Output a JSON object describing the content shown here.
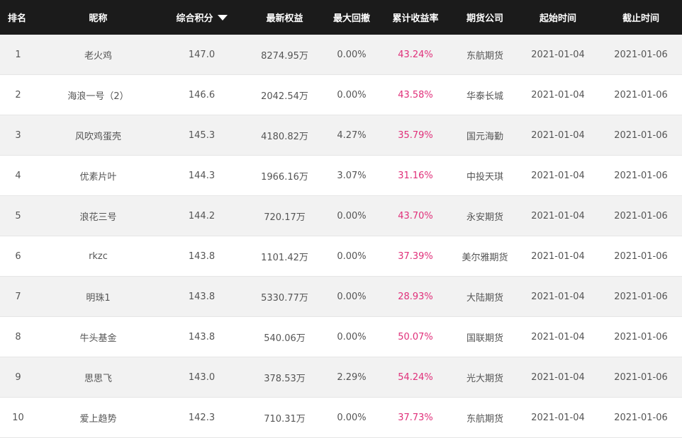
{
  "header": {
    "rank": "排名",
    "nickname": "昵称",
    "score": "综合积分",
    "equity": "最新权益",
    "drawdown": "最大回撤",
    "return": "累计收益率",
    "company": "期货公司",
    "start": "起始时间",
    "end": "截止时间"
  },
  "colors": {
    "header_bg": "#1b1b1b",
    "positive": "#e0307a",
    "stripe": "#f2f2f2"
  },
  "rows": [
    {
      "rank": "1",
      "nickname": "老火鸡",
      "score": "147.0",
      "equity": "8274.95万",
      "drawdown": "0.00%",
      "return": "43.24%",
      "company": "东航期货",
      "start": "2021-01-04",
      "end": "2021-01-06"
    },
    {
      "rank": "2",
      "nickname": "海浪一号（2）",
      "score": "146.6",
      "equity": "2042.54万",
      "drawdown": "0.00%",
      "return": "43.58%",
      "company": "华泰长城",
      "start": "2021-01-04",
      "end": "2021-01-06"
    },
    {
      "rank": "3",
      "nickname": "风吹鸡蛋壳",
      "score": "145.3",
      "equity": "4180.82万",
      "drawdown": "4.27%",
      "return": "35.79%",
      "company": "国元海勤",
      "start": "2021-01-04",
      "end": "2021-01-06"
    },
    {
      "rank": "4",
      "nickname": "优素片叶",
      "score": "144.3",
      "equity": "1966.16万",
      "drawdown": "3.07%",
      "return": "31.16%",
      "company": "中投天琪",
      "start": "2021-01-04",
      "end": "2021-01-06"
    },
    {
      "rank": "5",
      "nickname": "浪花三号",
      "score": "144.2",
      "equity": "720.17万",
      "drawdown": "0.00%",
      "return": "43.70%",
      "company": "永安期货",
      "start": "2021-01-04",
      "end": "2021-01-06"
    },
    {
      "rank": "6",
      "nickname": "rkzc",
      "score": "143.8",
      "equity": "1101.42万",
      "drawdown": "0.00%",
      "return": "37.39%",
      "company": "美尔雅期货",
      "start": "2021-01-04",
      "end": "2021-01-06"
    },
    {
      "rank": "7",
      "nickname": "明珠1",
      "score": "143.8",
      "equity": "5330.77万",
      "drawdown": "0.00%",
      "return": "28.93%",
      "company": "大陆期货",
      "start": "2021-01-04",
      "end": "2021-01-06"
    },
    {
      "rank": "8",
      "nickname": "牛头基金",
      "score": "143.8",
      "equity": "540.06万",
      "drawdown": "0.00%",
      "return": "50.07%",
      "company": "国联期货",
      "start": "2021-01-04",
      "end": "2021-01-06"
    },
    {
      "rank": "9",
      "nickname": "思思飞",
      "score": "143.0",
      "equity": "378.53万",
      "drawdown": "2.29%",
      "return": "54.24%",
      "company": "光大期货",
      "start": "2021-01-04",
      "end": "2021-01-06"
    },
    {
      "rank": "10",
      "nickname": "爱上趋势",
      "score": "142.3",
      "equity": "710.31万",
      "drawdown": "0.00%",
      "return": "37.73%",
      "company": "东航期货",
      "start": "2021-01-04",
      "end": "2021-01-06"
    }
  ]
}
